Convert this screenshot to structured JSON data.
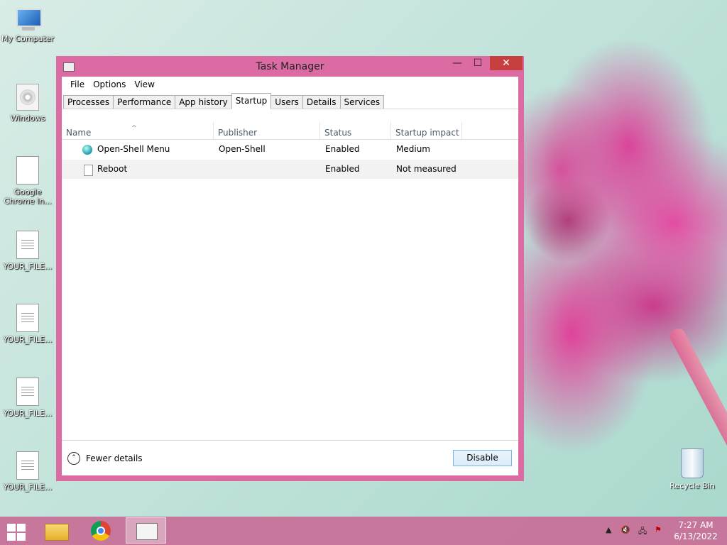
{
  "desktop": {
    "icons": [
      {
        "label": "My Computer"
      },
      {
        "label": "Windows"
      },
      {
        "label": "Google Chrome In..."
      },
      {
        "label": "YOUR_FILE..."
      },
      {
        "label": "YOUR_FILE..."
      },
      {
        "label": "YOUR_FILE..."
      },
      {
        "label": "YOUR_FILE..."
      }
    ],
    "recycle_bin": "Recycle Bin"
  },
  "window": {
    "title": "Task Manager",
    "controls": {
      "minimize": "—",
      "maximize": "☐",
      "close": "✕"
    },
    "menu": [
      "File",
      "Options",
      "View"
    ],
    "tabs": [
      "Processes",
      "Performance",
      "App history",
      "Startup",
      "Users",
      "Details",
      "Services"
    ],
    "active_tab": "Startup",
    "columns": [
      "Name",
      "Publisher",
      "Status",
      "Startup impact"
    ],
    "rows": [
      {
        "name": "Open-Shell Menu",
        "publisher": "Open-Shell",
        "status": "Enabled",
        "impact": "Medium",
        "icon": "open-shell-icon"
      },
      {
        "name": "Reboot",
        "publisher": "",
        "status": "Enabled",
        "impact": "Not measured",
        "icon": "blank-file-icon"
      }
    ],
    "fewer_details": "Fewer details",
    "disable_button": "Disable"
  },
  "taskbar": {
    "apps": [
      "file-explorer-icon",
      "chrome-icon",
      "task-manager-icon"
    ],
    "time": "7:27 AM",
    "date": "6/13/2022"
  }
}
